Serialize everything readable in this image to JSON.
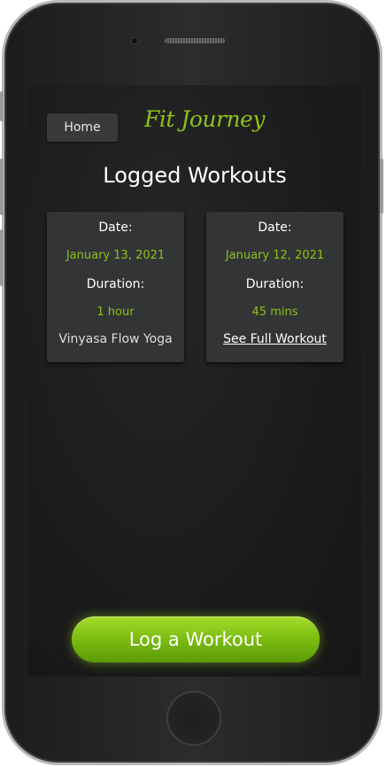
{
  "nav": {
    "home_label": "Home"
  },
  "app": {
    "brand": "Fit Journey"
  },
  "page": {
    "title": "Logged Workouts"
  },
  "workouts": [
    {
      "date_label": "Date:",
      "date": "January 13, 2021",
      "duration_label": "Duration:",
      "duration": "1 hour",
      "footer": "Vinyasa Flow Yoga"
    },
    {
      "date_label": "Date:",
      "date": "January 12, 2021",
      "duration_label": "Duration:",
      "duration": "45 mins",
      "footer": "See Full Workout"
    }
  ],
  "actions": {
    "log_workout_label": "Log a Workout"
  },
  "colors": {
    "accent": "#8ec21a",
    "card_bg": "#333436",
    "screen_bg": "#1b1b1b"
  }
}
